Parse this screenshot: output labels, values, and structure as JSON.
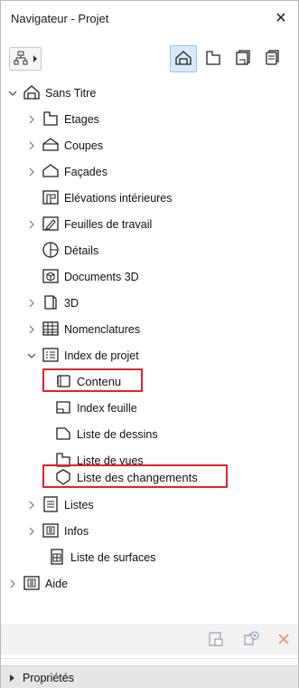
{
  "window": {
    "title": "Navigateur - Projet",
    "close_glyph": "✕"
  },
  "toolbar": {
    "map_dropdown_icon": "sitemap-icon",
    "views": [
      {
        "name": "project-map-view",
        "icon": "house-icon",
        "active": true
      },
      {
        "name": "view-map",
        "icon": "floor-plan-icon",
        "active": false
      },
      {
        "name": "layout-book",
        "icon": "layout-book-icon",
        "active": false
      },
      {
        "name": "publisher-sets",
        "icon": "publisher-icon",
        "active": false
      }
    ]
  },
  "tree": {
    "root": {
      "label": "Sans Titre",
      "icon": "house-icon",
      "expanded": true
    },
    "items": [
      {
        "label": "Etages",
        "icon": "stories-icon",
        "expandable": true
      },
      {
        "label": "Coupes",
        "icon": "section-icon",
        "expandable": true
      },
      {
        "label": "Façades",
        "icon": "elevation-icon",
        "expandable": true
      },
      {
        "label": "Elévations intérieures",
        "icon": "interior-elevation-icon",
        "expandable": false
      },
      {
        "label": "Feuilles de travail",
        "icon": "worksheet-icon",
        "expandable": true
      },
      {
        "label": "Détails",
        "icon": "detail-icon",
        "expandable": false
      },
      {
        "label": "Documents 3D",
        "icon": "document-3d-icon",
        "expandable": false
      },
      {
        "label": "3D",
        "icon": "cube-3d-icon",
        "expandable": true
      },
      {
        "label": "Nomenclatures",
        "icon": "schedule-icon",
        "expandable": true
      },
      {
        "label": "Index de projet",
        "icon": "project-index-icon",
        "expandable": true,
        "expanded": true
      }
    ],
    "index_children": [
      {
        "label": "Contenu",
        "icon": "book-icon",
        "highlighted": true
      },
      {
        "label": "Index feuille",
        "icon": "sheet-index-icon",
        "highlighted": false
      },
      {
        "label": "Liste de dessins",
        "icon": "drawing-list-icon",
        "highlighted": false
      },
      {
        "label": "Liste de vues",
        "icon": "view-list-icon",
        "highlighted": false
      },
      {
        "label": "Liste des changements",
        "icon": "change-list-icon",
        "highlighted": true
      }
    ],
    "after_items": [
      {
        "label": "Listes",
        "icon": "list-icon",
        "expandable": true
      },
      {
        "label": "Infos",
        "icon": "info-icon",
        "expandable": true
      },
      {
        "label": "Liste de surfaces",
        "icon": "surface-list-icon",
        "expandable": false
      }
    ],
    "help": {
      "label": "Aide",
      "icon": "help-icon",
      "expandable": true
    }
  },
  "footer": {
    "buttons": [
      "new-viewpoint-icon",
      "new-folder-icon",
      "delete-icon"
    ],
    "properties_label": "Propriétés"
  }
}
